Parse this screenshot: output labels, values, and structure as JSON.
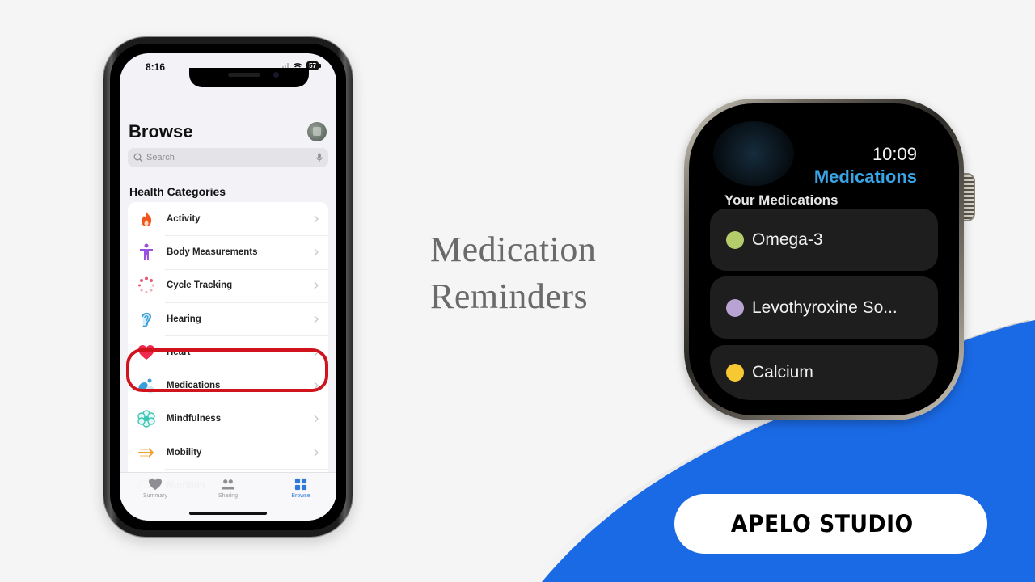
{
  "colors": {
    "background": "#f5f5f5",
    "accent_blue": "#1a6ae6",
    "highlight_red": "#d0131c",
    "watch_title_blue": "#3aa5e6",
    "tab_active": "#2f7ad8"
  },
  "headline": {
    "line1": "Medication",
    "line2": "Reminders"
  },
  "phone": {
    "status_bar": {
      "time": "8:16",
      "battery": "57",
      "icons": [
        "signal-icon",
        "wifi-icon",
        "battery-icon"
      ]
    },
    "header": {
      "title": "Browse",
      "avatar": "profile-avatar"
    },
    "search": {
      "placeholder": "Search",
      "icon": "search-icon",
      "mic_icon": "mic-icon"
    },
    "section_title": "Health Categories",
    "categories": [
      {
        "label": "Activity",
        "icon": "flame-icon",
        "color": "#f2561d"
      },
      {
        "label": "Body Measurements",
        "icon": "person-icon",
        "color": "#9b51e0"
      },
      {
        "label": "Cycle Tracking",
        "icon": "cycle-tracking-icon",
        "color": "#e85a6f"
      },
      {
        "label": "Hearing",
        "icon": "ear-icon",
        "color": "#3aa0d8"
      },
      {
        "label": "Heart",
        "icon": "heart-icon",
        "color": "#f0294f"
      },
      {
        "label": "Medications",
        "icon": "pills-icon",
        "color": "#3a9fd8",
        "highlighted": true
      },
      {
        "label": "Mindfulness",
        "icon": "flower-icon",
        "color": "#3cc6b5"
      },
      {
        "label": "Mobility",
        "icon": "mobility-arrows-icon",
        "color": "#f0a030"
      },
      {
        "label": "Nutrition",
        "icon": "apple-icon",
        "color": "#47b04a"
      }
    ],
    "tabbar": [
      {
        "label": "Summary",
        "icon": "heart-icon",
        "active": false
      },
      {
        "label": "Sharing",
        "icon": "people-icon",
        "active": false
      },
      {
        "label": "Browse",
        "icon": "grid-icon",
        "active": true
      }
    ]
  },
  "watch": {
    "time": "10:09",
    "app_title": "Medications",
    "section_title": "Your Medications",
    "medications": [
      {
        "name": "Omega-3",
        "dot_color": "#b5cc6a"
      },
      {
        "name": "Levothyroxine So...",
        "dot_color": "#b8a3d2"
      },
      {
        "name": "Calcium",
        "dot_color": "#f6c932"
      }
    ]
  },
  "brand": {
    "label": "APELO STUDIO"
  }
}
